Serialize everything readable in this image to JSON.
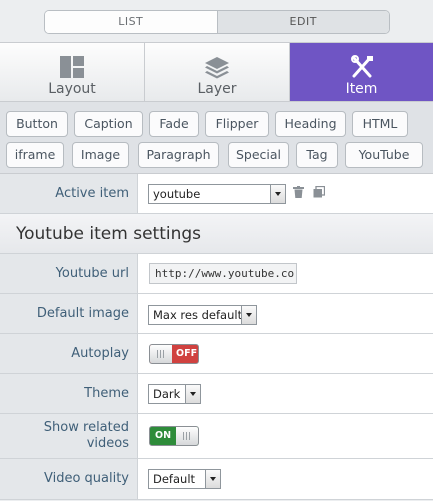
{
  "mode_switch": {
    "list_label": "LIST",
    "edit_label": "EDIT",
    "active": "EDIT"
  },
  "main_tabs": [
    {
      "label": "Layout",
      "icon": "layout-icon"
    },
    {
      "label": "Layer",
      "icon": "layer-stack-icon"
    },
    {
      "label": "Item",
      "icon": "item-tools-icon",
      "active": true
    }
  ],
  "item_types": [
    "Button",
    "Caption",
    "Fade",
    "Flipper",
    "Heading",
    "HTML",
    "iframe",
    "Image",
    "Paragraph",
    "Special",
    "Tag",
    "YouTube"
  ],
  "active_item": {
    "label": "Active item",
    "value": "youtube",
    "delete_icon": "trash-icon",
    "duplicate_icon": "duplicate-icon"
  },
  "section_title": "Youtube item settings",
  "settings": {
    "url": {
      "label": "Youtube url",
      "value": "http://www.youtube.cor"
    },
    "default_image": {
      "label": "Default image",
      "value": "Max res default"
    },
    "autoplay": {
      "label": "Autoplay",
      "state": "OFF"
    },
    "theme": {
      "label": "Theme",
      "value": "Dark"
    },
    "show_related": {
      "label": "Show related videos",
      "state": "ON"
    },
    "video_quality": {
      "label": "Video quality",
      "value": "Default"
    }
  },
  "colors": {
    "accent": "#6f55c4",
    "toggle_off": "#d0413f",
    "toggle_on": "#2e8c3a",
    "label_text": "#3f5f78"
  }
}
